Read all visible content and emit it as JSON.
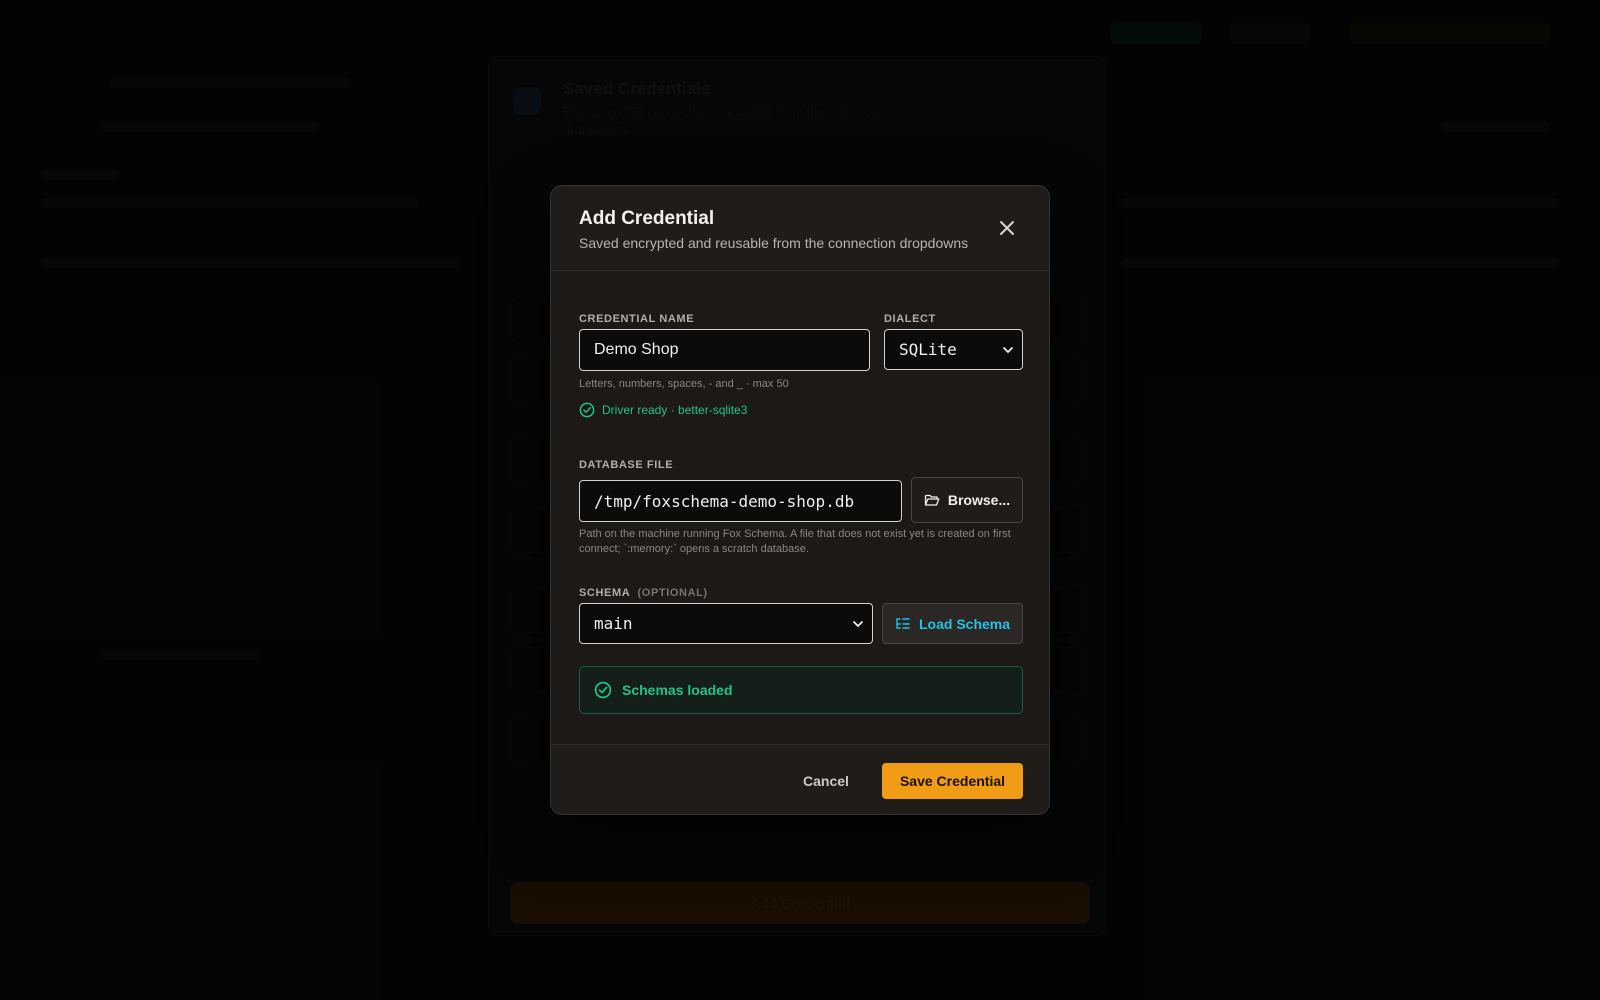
{
  "background": {
    "panel_title": "Saved Credentials",
    "panel_subtitle": "Encrypted DB connections, reusable from the connection dropdowns",
    "add_button_label": "Add Credential"
  },
  "modal": {
    "title": "Add Credential",
    "subtitle": "Saved encrypted and reusable from the connection dropdowns",
    "credential_name": {
      "label": "Credential Name",
      "value": "Demo Shop",
      "hint": "Letters, numbers, spaces, - and _ · max 50"
    },
    "dialect": {
      "label": "Dialect",
      "selected": "SQLite"
    },
    "driver_status": "Driver ready · better-sqlite3",
    "database_file": {
      "label": "Database File",
      "value": "/tmp/foxschema-demo-shop.db",
      "browse_label": "Browse...",
      "hint": "Path on the machine running Fox Schema. A file that does not exist yet is created on first connect; `:memory:` opens a scratch database."
    },
    "schema": {
      "label": "Schema",
      "optional_tag": "(Optional)",
      "selected": "main",
      "load_label": "Load Schema",
      "status": "Schemas loaded"
    },
    "footer": {
      "cancel_label": "Cancel",
      "save_label": "Save Credential"
    }
  },
  "colors": {
    "accent": "#f19c16",
    "success": "#22c28a",
    "link": "#22c3e6"
  }
}
